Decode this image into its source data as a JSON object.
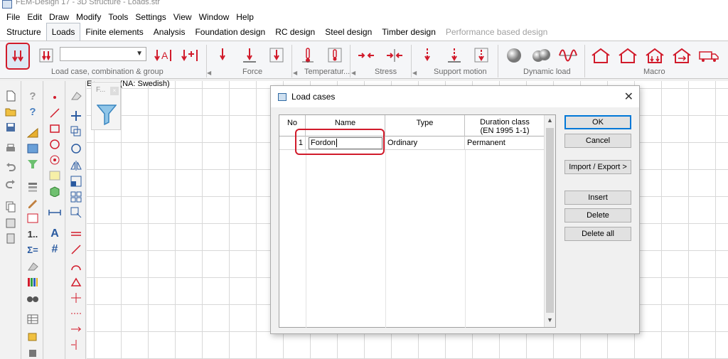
{
  "window": {
    "title": "FEM-Design 17 - 3D Structure - Loads.str"
  },
  "menu": [
    "File",
    "Edit",
    "Draw",
    "Modify",
    "Tools",
    "Settings",
    "View",
    "Window",
    "Help"
  ],
  "tabs": [
    {
      "label": "Structure",
      "state": "normal"
    },
    {
      "label": "Loads",
      "state": "active"
    },
    {
      "label": "Finite elements",
      "state": "normal"
    },
    {
      "label": "Analysis",
      "state": "normal"
    },
    {
      "label": "Foundation design",
      "state": "normal"
    },
    {
      "label": "RC design",
      "state": "normal"
    },
    {
      "label": "Steel design",
      "state": "normal"
    },
    {
      "label": "Timber design",
      "state": "normal"
    },
    {
      "label": "Performance based design",
      "state": "disabled"
    }
  ],
  "ribbon": {
    "groups": [
      "Load case, combination & group",
      "Force",
      "Temperatur...",
      "Stress",
      "Support motion",
      "Dynamic load",
      "Macro"
    ],
    "combo_value": ""
  },
  "canvas": {
    "header_suffix": "(NA: Swedish)",
    "header_prefix": "E",
    "mini_panel_label": "F..."
  },
  "dialog": {
    "title": "Load cases",
    "columns": [
      "No",
      "Name",
      "Type",
      "Duration class",
      "(EN 1995 1-1)"
    ],
    "rows": [
      {
        "no": "1",
        "name": "Fordon",
        "type": "Ordinary",
        "duration": "Permanent"
      }
    ],
    "buttons": {
      "ok": "OK",
      "cancel": "Cancel",
      "import_export": "Import / Export >",
      "insert": "Insert",
      "delete": "Delete",
      "delete_all": "Delete all"
    }
  },
  "colors": {
    "accent_red": "#d11b2b",
    "grid_line": "#d8d8d8"
  }
}
